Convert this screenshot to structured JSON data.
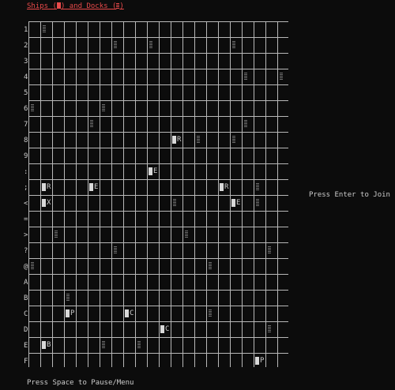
{
  "title": {
    "prefix": "Ships (",
    "middle": ") and Docks (",
    "suffix": ")"
  },
  "row_labels": [
    "1",
    "2",
    "3",
    "4",
    "5",
    "6",
    "7",
    "8",
    "9",
    ":",
    ";",
    "<",
    "=",
    ">",
    "?",
    "@",
    "A",
    "B",
    "C",
    "D",
    "E",
    "F"
  ],
  "board": {
    "columns": 22,
    "rows": 22,
    "ships": [
      {
        "row": 7,
        "col": 12,
        "letter": "R"
      },
      {
        "row": 9,
        "col": 10,
        "letter": "E"
      },
      {
        "row": 10,
        "col": 1,
        "letter": "R"
      },
      {
        "row": 10,
        "col": 5,
        "letter": "E"
      },
      {
        "row": 10,
        "col": 16,
        "letter": "R"
      },
      {
        "row": 11,
        "col": 1,
        "letter": "X"
      },
      {
        "row": 11,
        "col": 17,
        "letter": "E"
      },
      {
        "row": 18,
        "col": 3,
        "letter": "P"
      },
      {
        "row": 18,
        "col": 8,
        "letter": "C"
      },
      {
        "row": 19,
        "col": 11,
        "letter": "C"
      },
      {
        "row": 20,
        "col": 1,
        "letter": "B"
      },
      {
        "row": 21,
        "col": 19,
        "letter": "P"
      }
    ],
    "docks": [
      {
        "row": 0,
        "col": 1
      },
      {
        "row": 1,
        "col": 7
      },
      {
        "row": 1,
        "col": 10
      },
      {
        "row": 1,
        "col": 17
      },
      {
        "row": 3,
        "col": 18
      },
      {
        "row": 3,
        "col": 21
      },
      {
        "row": 5,
        "col": 0
      },
      {
        "row": 5,
        "col": 6
      },
      {
        "row": 6,
        "col": 5
      },
      {
        "row": 6,
        "col": 18
      },
      {
        "row": 7,
        "col": 14
      },
      {
        "row": 7,
        "col": 17
      },
      {
        "row": 10,
        "col": 19
      },
      {
        "row": 11,
        "col": 12
      },
      {
        "row": 11,
        "col": 19
      },
      {
        "row": 13,
        "col": 2
      },
      {
        "row": 13,
        "col": 13
      },
      {
        "row": 14,
        "col": 7
      },
      {
        "row": 14,
        "col": 20
      },
      {
        "row": 15,
        "col": 0
      },
      {
        "row": 15,
        "col": 15
      },
      {
        "row": 17,
        "col": 3
      },
      {
        "row": 18,
        "col": 15
      },
      {
        "row": 19,
        "col": 20
      },
      {
        "row": 20,
        "col": 6
      },
      {
        "row": 20,
        "col": 9
      }
    ]
  },
  "prompts": {
    "join": "Press Enter to Join",
    "pause": "Press Space to Pause/Menu"
  },
  "colors": {
    "title": "#e84a4a",
    "grid": "#b8b8b8",
    "ship": "#d9d9d9",
    "dock": "#6e6e6e",
    "background": "#0c0c0c"
  }
}
